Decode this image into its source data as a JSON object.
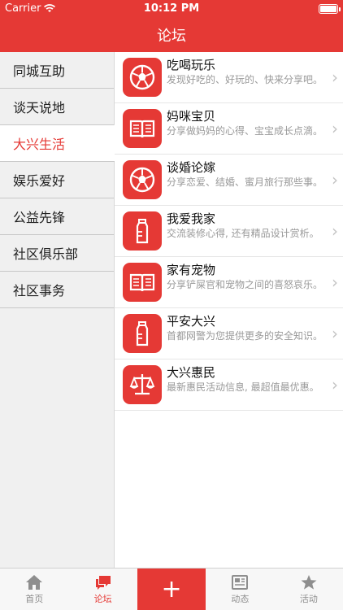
{
  "status": {
    "carrier": "Carrier",
    "time": "10:12 PM"
  },
  "header": {
    "title": "论坛"
  },
  "sidebar": {
    "items": [
      {
        "label": "同城互助"
      },
      {
        "label": "谈天说地"
      },
      {
        "label": "大兴生活"
      },
      {
        "label": "娱乐爱好"
      },
      {
        "label": "公益先锋"
      },
      {
        "label": "社区俱乐部"
      },
      {
        "label": "社区事务"
      }
    ],
    "active_index": 2
  },
  "forums": [
    {
      "title": "吃喝玩乐",
      "desc": "发现好吃的、好玩的、快来分享吧。",
      "icon": "football-icon"
    },
    {
      "title": "妈咪宝贝",
      "desc": "分享做妈妈的心得、宝宝成长点滴。",
      "icon": "book-icon"
    },
    {
      "title": "谈婚论嫁",
      "desc": "分享恋爱、结婚、蜜月旅行那些事。",
      "icon": "football-icon"
    },
    {
      "title": "我爱我家",
      "desc": "交流装修心得, 还有精品设计赏析。",
      "icon": "bottle-icon"
    },
    {
      "title": "家有宠物",
      "desc": "分享铲屎官和宠物之间的喜怒哀乐。",
      "icon": "book-icon"
    },
    {
      "title": "平安大兴",
      "desc": "首都网警为您提供更多的安全知识。",
      "icon": "bottle-icon"
    },
    {
      "title": "大兴惠民",
      "desc": "最新惠民活动信息, 最超值最优惠。",
      "icon": "scale-icon"
    }
  ],
  "tabs": [
    {
      "label": "首页",
      "icon": "home-icon"
    },
    {
      "label": "论坛",
      "icon": "chat-icon"
    },
    {
      "label": "+",
      "icon": "plus-icon"
    },
    {
      "label": "动态",
      "icon": "news-icon"
    },
    {
      "label": "活动",
      "icon": "star-icon"
    }
  ],
  "colors": {
    "brand": "#e53935",
    "text_muted": "#999999",
    "sidebar_bg": "#f0f0f0"
  }
}
